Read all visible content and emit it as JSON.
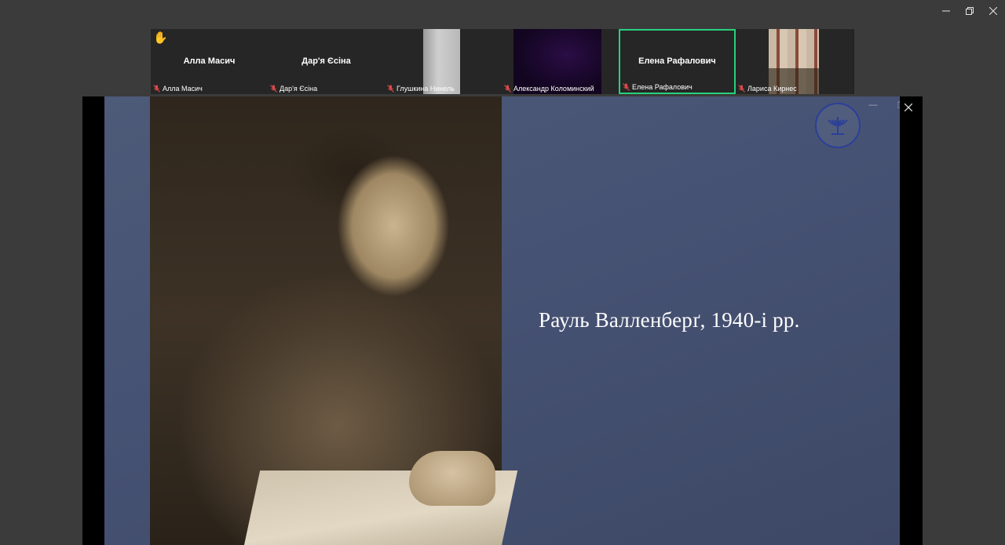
{
  "window": {
    "controls": {
      "minimize_icon": "minimize-icon",
      "restore_icon": "restore-icon",
      "close_icon": "close-icon"
    }
  },
  "participants": [
    {
      "center_name": "Алла Масич",
      "label": "Алла Масич",
      "muted": true,
      "hand_raised": true,
      "video": "none"
    },
    {
      "center_name": "Дар'я Єсіна",
      "label": "Дар'я Єсіна",
      "muted": true,
      "video": "none"
    },
    {
      "center_name": "",
      "label": "Глушкина Нинель",
      "muted": true,
      "video": "photo"
    },
    {
      "center_name": "",
      "label": "Александр Коломинский",
      "muted": true,
      "video": "purple"
    },
    {
      "center_name": "Елена Рафалович",
      "label": "Елена Рафалович",
      "muted": true,
      "video": "none",
      "active_speaker": true
    },
    {
      "center_name": "",
      "label": "Лариса Кирнес",
      "muted": true,
      "video": "room"
    }
  ],
  "share": {
    "slide_title": "Рауль Валленберґ, 1940-і рр.",
    "colors": {
      "slide_bg": "#465273",
      "active_border": "#26d07c",
      "muted_icon": "#e04a4a"
    }
  }
}
